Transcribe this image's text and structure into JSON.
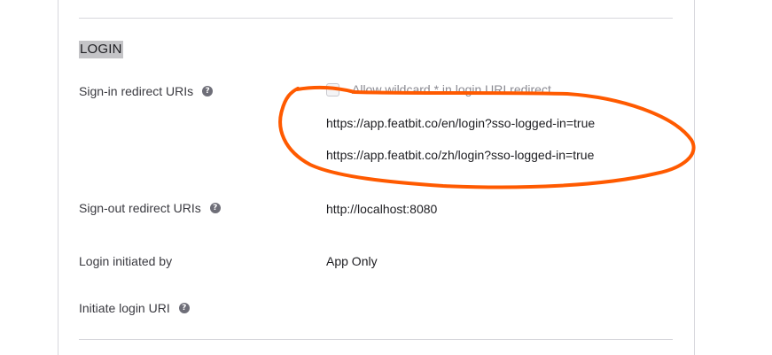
{
  "section": {
    "title": "LOGIN"
  },
  "sign_in": {
    "label": "Sign-in redirect URIs",
    "help_icon": "question-circle-icon",
    "wildcard_label": "Allow wildcard * in login URI redirect",
    "wildcard_checked": false,
    "uris": [
      "https://app.featbit.co/en/login?sso-logged-in=true",
      "https://app.featbit.co/zh/login?sso-logged-in=true"
    ]
  },
  "sign_out": {
    "label": "Sign-out redirect URIs",
    "help_icon": "question-circle-icon",
    "uri": "http://localhost:8080"
  },
  "login_initiated": {
    "label": "Login initiated by",
    "value": "App Only"
  },
  "initiate_login_uri": {
    "label": "Initiate login URI",
    "help_icon": "question-circle-icon",
    "value": ""
  },
  "annotation": {
    "color": "#ff5a00"
  }
}
